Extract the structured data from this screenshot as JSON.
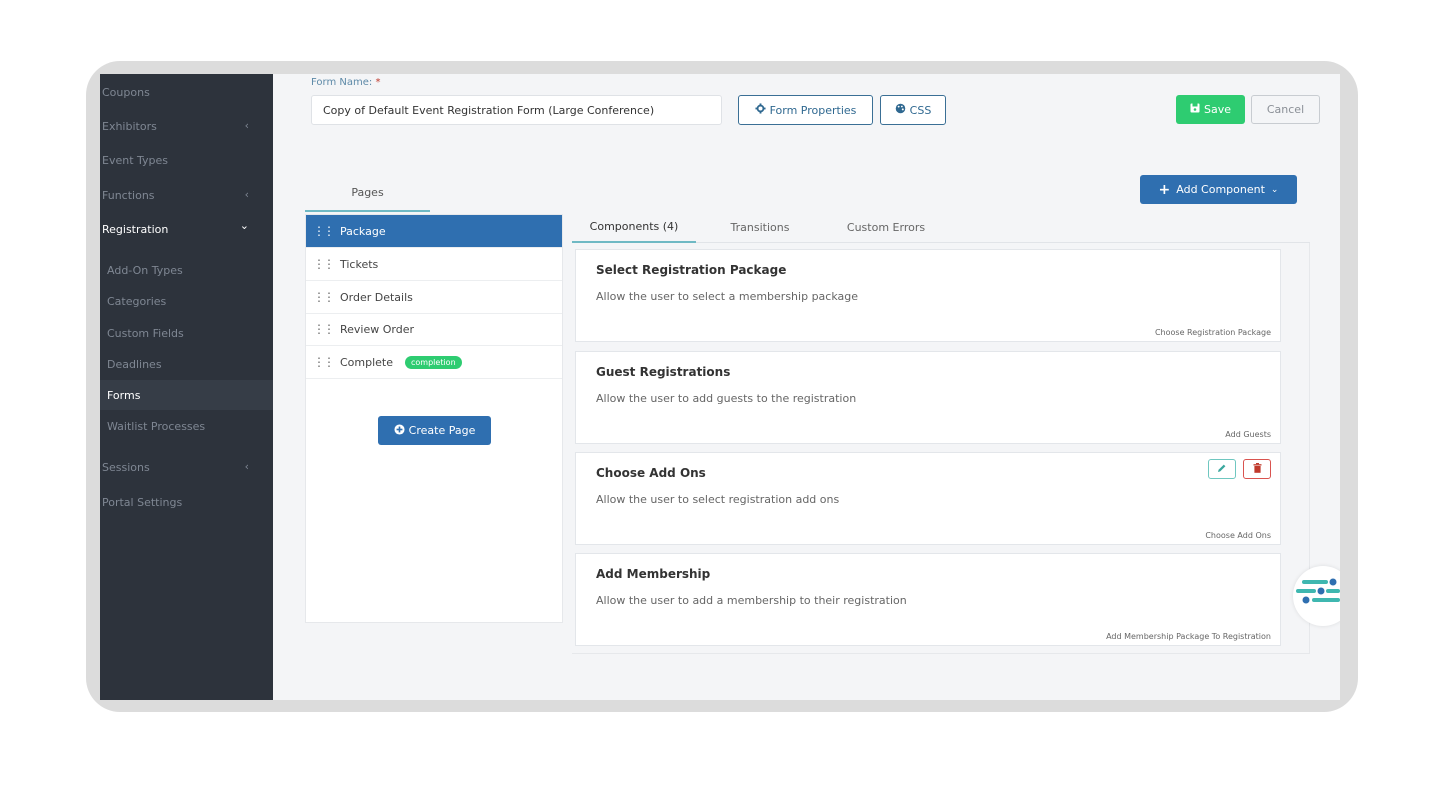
{
  "sidebar": {
    "items": [
      {
        "label": "Coupons"
      },
      {
        "label": "Exhibitors",
        "chevron": "‹"
      },
      {
        "label": "Event Types"
      },
      {
        "label": "Functions",
        "chevron": "‹"
      },
      {
        "label": "Registration",
        "chevron": "⌄"
      },
      {
        "label": "Sessions",
        "chevron": "‹"
      },
      {
        "label": "Portal Settings"
      }
    ],
    "sub_items": [
      {
        "label": "Add-On Types"
      },
      {
        "label": "Categories"
      },
      {
        "label": "Custom Fields"
      },
      {
        "label": "Deadlines"
      },
      {
        "label": "Forms"
      },
      {
        "label": "Waitlist Processes"
      }
    ]
  },
  "form": {
    "label": "Form Name:",
    "required_mark": "*",
    "name_value": "Copy of Default Event Registration Form (Large Conference)",
    "properties_label": "Form Properties",
    "css_label": "CSS"
  },
  "toolbar": {
    "save_label": "Save",
    "cancel_label": "Cancel",
    "add_component_label": "Add Component"
  },
  "pages": {
    "tab_label": "Pages",
    "items": [
      {
        "label": "Package"
      },
      {
        "label": "Tickets"
      },
      {
        "label": "Order Details"
      },
      {
        "label": "Review Order"
      },
      {
        "label": "Complete",
        "badge": "completion"
      }
    ],
    "create_label": "Create Page"
  },
  "tabs": [
    {
      "label": "Components (4)"
    },
    {
      "label": "Transitions"
    },
    {
      "label": "Custom Errors"
    }
  ],
  "components": [
    {
      "title": "Select Registration Package",
      "desc": "Allow the user to select a membership package",
      "key": "Choose Registration Package"
    },
    {
      "title": "Guest Registrations",
      "desc": "Allow the user to add guests to the registration",
      "key": "Add Guests"
    },
    {
      "title": "Choose Add Ons",
      "desc": "Allow the user to select registration add ons",
      "key": "Choose Add Ons"
    },
    {
      "title": "Add Membership",
      "desc": "Allow the user to add a membership to their registration",
      "key": "Add Membership Package To Registration"
    }
  ],
  "colors": {
    "sidebar_bg": "#2d333c",
    "primary": "#2f6fb0",
    "success": "#2ecc71",
    "accent": "#6fb9c4",
    "danger": "#d9534f"
  },
  "icons": {
    "gear": "gear-icon",
    "palette": "palette-icon",
    "save": "floppy-icon",
    "plus": "plus-icon",
    "grip": "drag-handle-icon",
    "edit": "pencil-icon",
    "delete": "trash-icon"
  }
}
